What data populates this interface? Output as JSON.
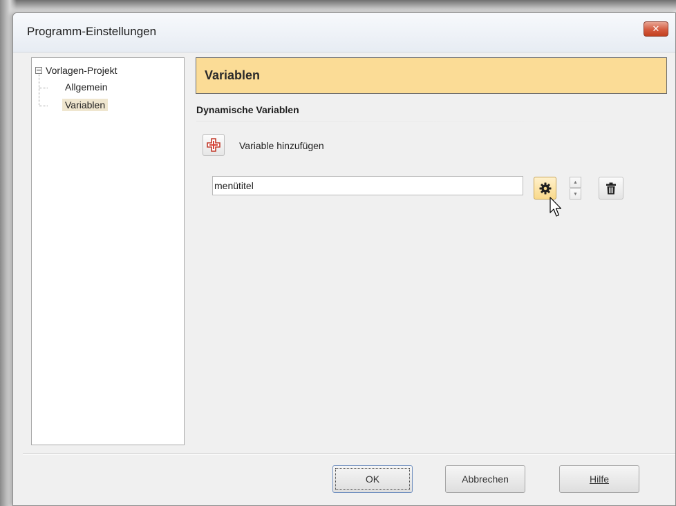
{
  "window": {
    "title": "Programm-Einstellungen",
    "close_icon": "close-icon"
  },
  "tree": {
    "root": "Vorlagen-Projekt",
    "items": [
      {
        "label": "Allgemein",
        "selected": false
      },
      {
        "label": "Variablen",
        "selected": true
      }
    ]
  },
  "content": {
    "header": "Variablen",
    "section_title": "Dynamische Variablen",
    "add_label": "Variable hinzufügen",
    "variable_value": "menütitel"
  },
  "footer": {
    "ok": "OK",
    "cancel": "Abbrechen",
    "help": "Hilfe"
  },
  "colors": {
    "header_bg": "#fbdc96",
    "selected_bg": "#efe6cf",
    "close_red": "#d45a3f",
    "gear_bg": "#f9d98a"
  }
}
